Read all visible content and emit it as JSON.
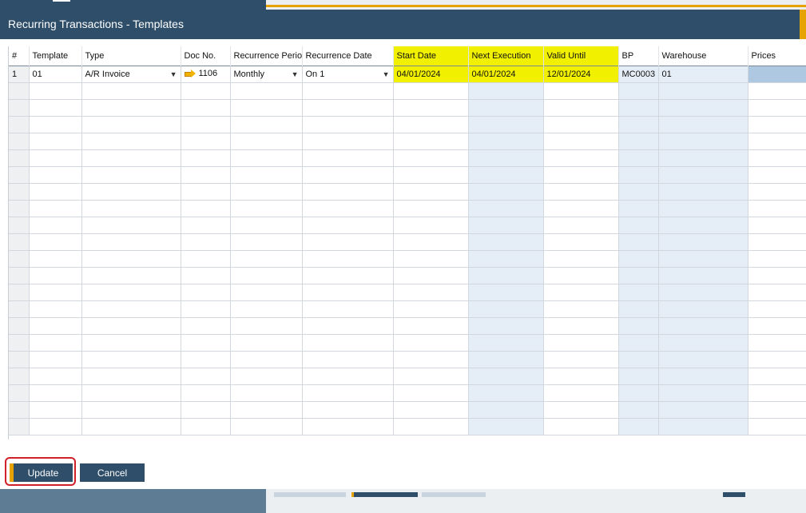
{
  "window": {
    "title": "Recurring Transactions - Templates"
  },
  "columns": [
    "#",
    "Template",
    "Type",
    "Doc No.",
    "Recurrence Period",
    "Recurrence Date",
    "Start Date",
    "Next Execution",
    "Valid Until",
    "BP",
    "Warehouse",
    "Prices"
  ],
  "row1": {
    "num": "1",
    "template": "01",
    "type": "A/R Invoice",
    "doc_no": "1106",
    "period": "Monthly",
    "date": "On 1",
    "start": "04/01/2024",
    "next": "04/01/2024",
    "valid": "12/01/2024",
    "bp": "MC0003",
    "warehouse": "01",
    "prices": ""
  },
  "buttons": {
    "update": "Update",
    "cancel": "Cancel"
  },
  "colors": {
    "header_bg": "#2e4e6a",
    "accent": "#e6a300",
    "highlight": "#f0f000",
    "outline": "#d0202a"
  }
}
